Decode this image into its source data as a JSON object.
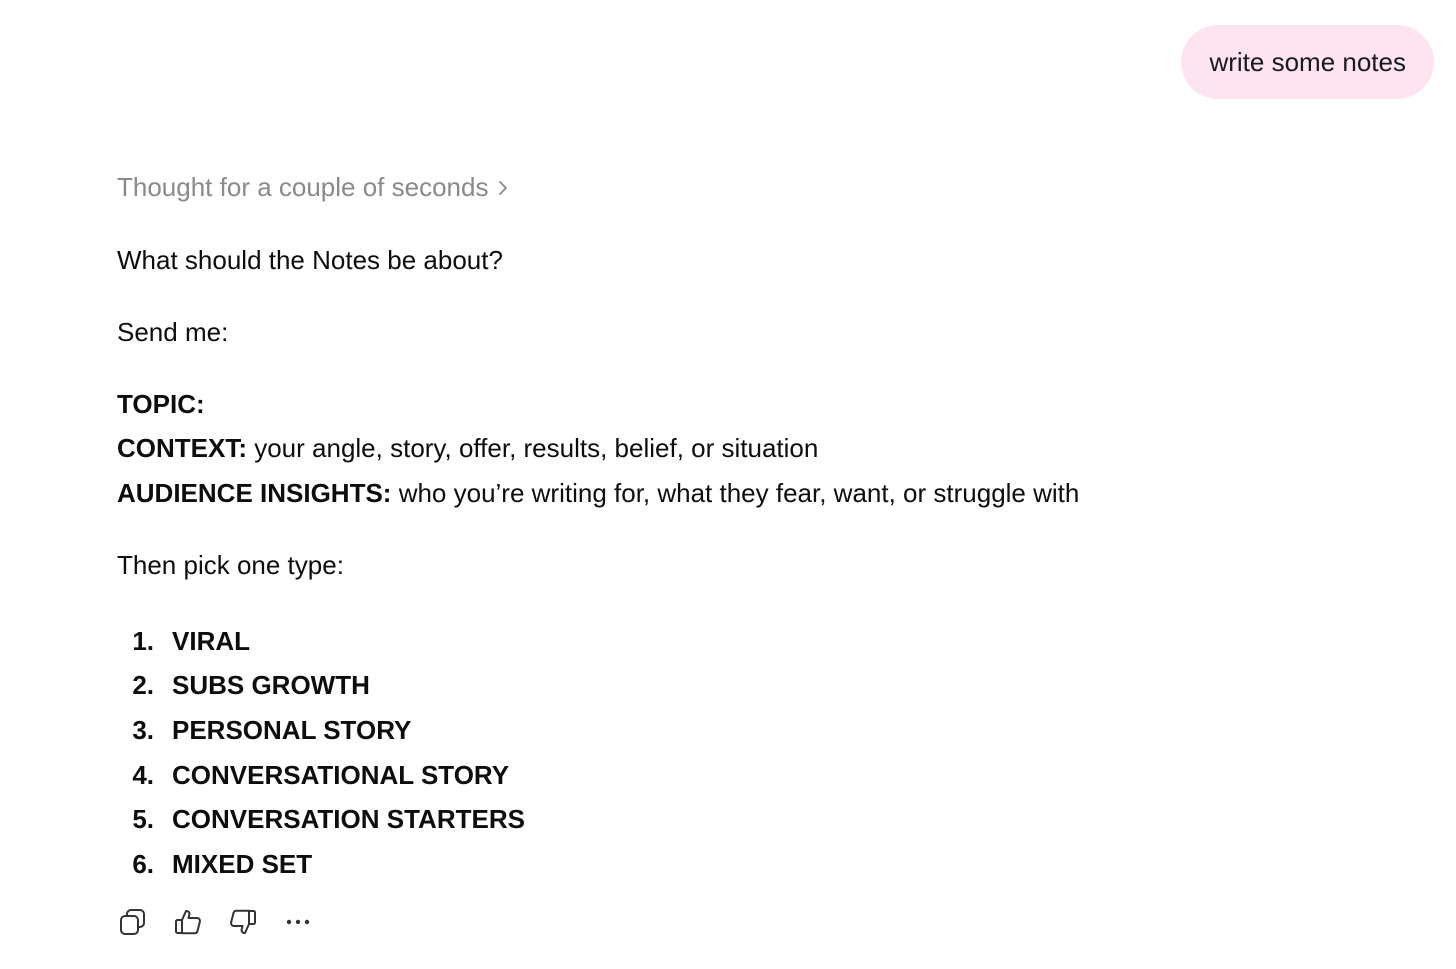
{
  "user_message": "write some notes",
  "assistant": {
    "thought_label": "Thought for a couple of seconds",
    "question": "What should the Notes be about?",
    "send_me": "Send me:",
    "fields": [
      {
        "label": "TOPIC:",
        "text": ""
      },
      {
        "label": "CONTEXT:",
        "text": " your angle, story, offer, results, belief, or situation"
      },
      {
        "label": "AUDIENCE INSIGHTS:",
        "text": " who you’re writing for, what they fear, want, or struggle with"
      }
    ],
    "pick_type": "Then pick one type:",
    "types": [
      {
        "num": "1.",
        "label": "VIRAL"
      },
      {
        "num": "2.",
        "label": "SUBS GROWTH"
      },
      {
        "num": "3.",
        "label": "PERSONAL STORY"
      },
      {
        "num": "4.",
        "label": "CONVERSATIONAL STORY"
      },
      {
        "num": "5.",
        "label": "CONVERSATION STARTERS"
      },
      {
        "num": "6.",
        "label": "MIXED SET"
      }
    ]
  },
  "actions": {
    "icons": [
      "copy-icon",
      "thumbs-up-icon",
      "thumbs-down-icon",
      "more-icon"
    ]
  },
  "colors": {
    "user_bubble": "#fde4f0",
    "muted_text": "#8a8a8a",
    "text": "#0d0d0d"
  }
}
